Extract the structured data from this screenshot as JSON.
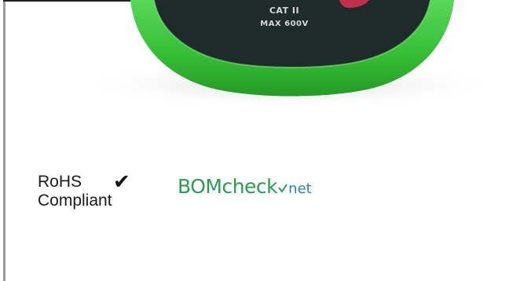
{
  "product_image": {
    "label_line1": "CAT II",
    "label_line2": "MAX 600V",
    "colors": {
      "holster_green": "#3cc13c",
      "body_dark": "#1f2a2a",
      "accent_red": "#c0304a"
    }
  },
  "rohs": {
    "line1": "RoHS",
    "line2": "Compliant",
    "check_icon": "checkmark-icon"
  },
  "bomcheck": {
    "main": "BOMcheck",
    "suffix": "net",
    "colors": {
      "brand_green": "#2e9a52",
      "brand_blue": "#2f7fbf"
    }
  }
}
